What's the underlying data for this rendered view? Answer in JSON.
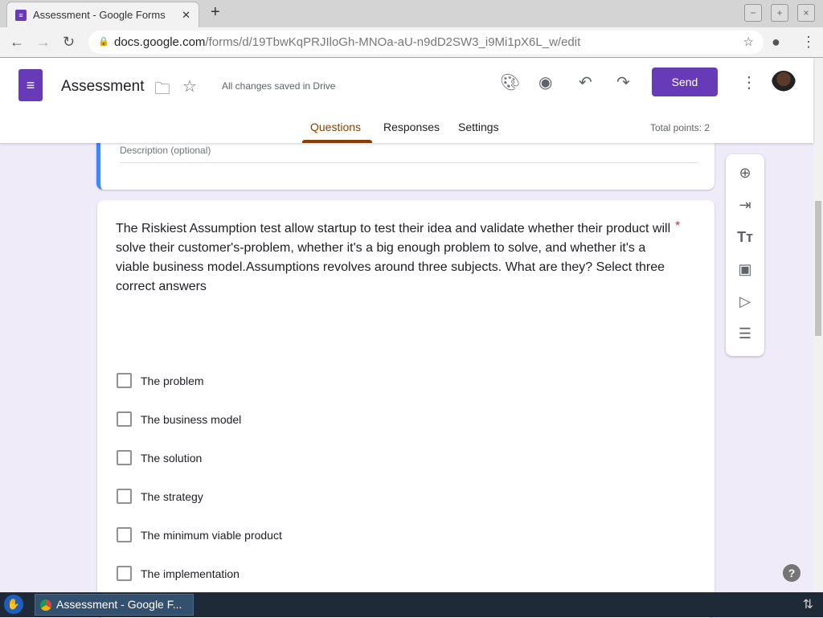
{
  "browser": {
    "tab_title": "Assessment - Google Forms",
    "url_domain": "docs.google.com",
    "url_path": "/forms/d/19TbwKqPRJIloGh-MNOa-aU-n9dD2SW3_i9Mi1pX6L_w/edit"
  },
  "header": {
    "title": "Assessment",
    "save_status": "All changes saved in Drive",
    "send_label": "Send",
    "tabs": [
      {
        "label": "Questions"
      },
      {
        "label": "Responses"
      },
      {
        "label": "Settings"
      }
    ],
    "total_points": "Total points: 2"
  },
  "description_placeholder": "Description (optional)",
  "question": {
    "text": "The Riskiest Assumption test allow startup to test their idea and validate whether their product will solve their customer's-problem,  whether it's a big enough problem to solve, and whether it's a viable business model.Assumptions revolves around three subjects. What are they? Select three correct answers",
    "required_mark": "*",
    "options": [
      "The problem",
      "The business model",
      "The solution",
      "The strategy",
      "The minimum viable  product",
      "The implementation"
    ]
  },
  "taskbar": {
    "task_label": "Assessment - Google F..."
  },
  "colors": {
    "accent": "#673ab7",
    "tab_active": "#8b3e00"
  }
}
